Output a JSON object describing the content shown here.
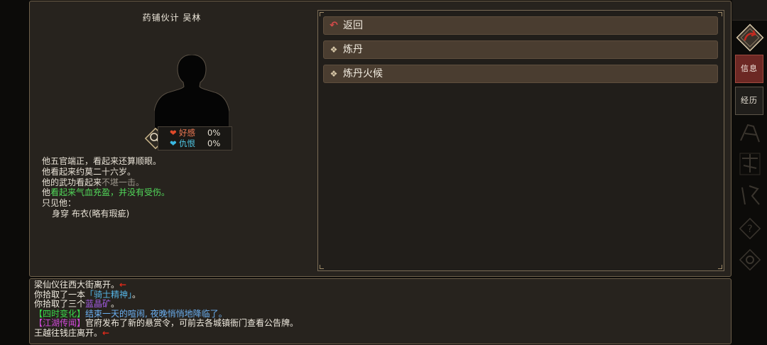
{
  "npc": {
    "title": "药铺伙计 吴林",
    "relations": [
      {
        "label": "好感",
        "value": "0%",
        "color": "#e04a2a"
      },
      {
        "label": "仇恨",
        "value": "0%",
        "color": "#3ab8e2"
      }
    ],
    "description": {
      "line1": "他五官端正，看起来还算顺眼。",
      "line2": "他看起来约莫二十六岁。",
      "line3_prefix": "他的武功看起来",
      "line3_highlight": "不堪一击。",
      "line4_prefix": "他",
      "line4_highlight": "看起来气血充盈，并没有受伤。",
      "line5": "只见他：",
      "line6": "身穿 布衣(略有瑕疵)"
    }
  },
  "menu": {
    "back": "返回",
    "items": [
      "炼丹",
      "炼丹火候"
    ]
  },
  "sidebar": {
    "info": "信息",
    "experience": "经历"
  },
  "log": {
    "l1_text": "梁仙仪往西大街离开。",
    "arrow": "←",
    "l2_prefix": "你拾取了一本",
    "l2_item": "「骑士精神」",
    "l2_suffix": "。",
    "l3_prefix": "你拾取了三个",
    "l3_item": "蓝晶矿",
    "l3_suffix": "。",
    "l4_tag": "【四时变化】",
    "l4_text": "结束一天的喧闹, 夜晚悄悄地降临了。",
    "l5_tag": "【江湖传闻】",
    "l5_text": "官府发布了新的悬赏令，可前去各城镇衙门查看公告牌。",
    "l6_text": "王越往钱庄离开。"
  },
  "icons": [
    "navigate-back-icon",
    "shape-icon",
    "return-arrow-icon",
    "diamond-icon",
    "heart-icon"
  ],
  "colors": {
    "favor": "#e04a2a",
    "hatred": "#3ab8e2",
    "button_bg": "#4a3d30",
    "info_button": "#6c2824",
    "highlight_green": "#52d85a"
  }
}
